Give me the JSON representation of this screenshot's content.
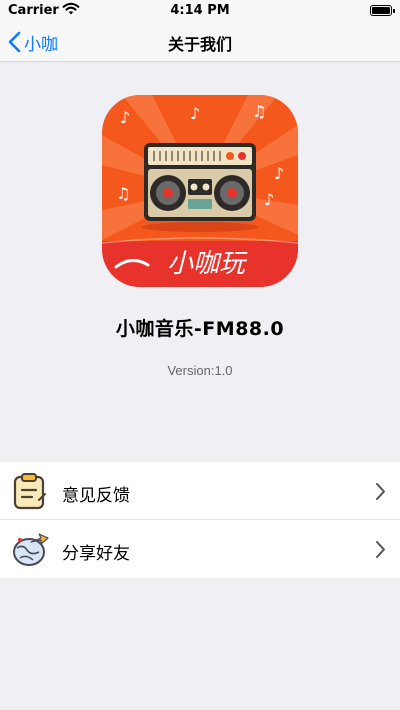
{
  "status_bar": {
    "carrier": "Carrier",
    "time": "4:14 PM"
  },
  "nav": {
    "back_label": "小咖",
    "title": "关于我们"
  },
  "app": {
    "logo_text": "小咖玩",
    "name": "小咖音乐-FM88.0",
    "version": "Version:1.0"
  },
  "menu": {
    "items": [
      {
        "label": "意见反馈",
        "icon": "clipboard-icon"
      },
      {
        "label": "分享好友",
        "icon": "share-globe-icon"
      }
    ]
  },
  "colors": {
    "accent": "#0a7aff",
    "logo_orange": "#f4581d",
    "logo_red": "#e8322c",
    "background": "#efeff4"
  }
}
